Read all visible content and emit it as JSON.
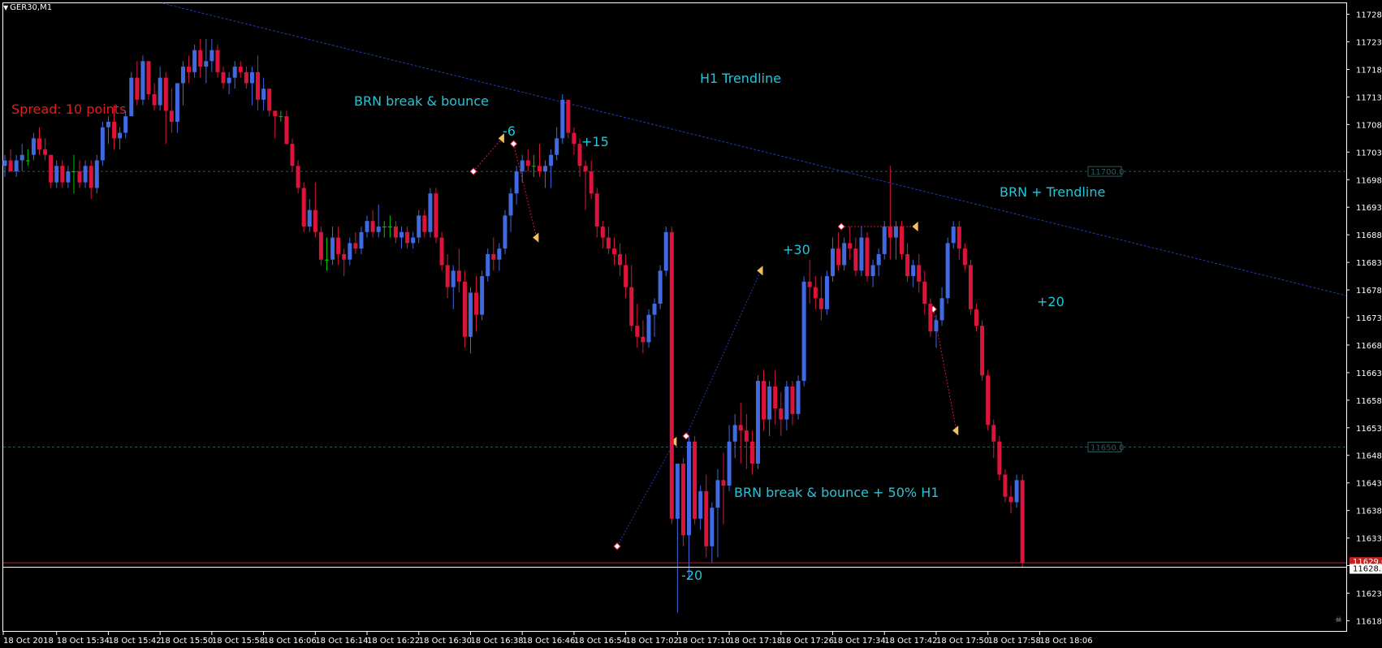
{
  "symbol_title": "GER30,M1",
  "chart_data": {
    "type": "candlestick",
    "title": "GER30,M1",
    "xlabel": "",
    "ylabel": "",
    "ylim": [
      11616.5,
      11730.5
    ],
    "price_ticks": [
      "11728.5",
      "11723.5",
      "11718.5",
      "11713.5",
      "11708.5",
      "11703.5",
      "11698.5",
      "11693.5",
      "11688.5",
      "11683.5",
      "11678.5",
      "11673.5",
      "11668.5",
      "11663.5",
      "11658.5",
      "11653.5",
      "11648.5",
      "11643.5",
      "11638.5",
      "11633.5",
      "11628.5",
      "11623.5",
      "11618.5"
    ],
    "time_ticks": [
      "18 Oct 2018",
      "18 Oct 15:34",
      "18 Oct 15:42",
      "18 Oct 15:50",
      "18 Oct 15:58",
      "18 Oct 16:06",
      "18 Oct 16:14",
      "18 Oct 16:22",
      "18 Oct 16:30",
      "18 Oct 16:38",
      "18 Oct 16:46",
      "18 Oct 16:54",
      "18 Oct 17:02",
      "18 Oct 17:10",
      "18 Oct 17:18",
      "18 Oct 17:26",
      "18 Oct 17:34",
      "18 Oct 17:42",
      "18 Oct 17:50",
      "18 Oct 17:58",
      "18 Oct 18:06"
    ],
    "grid": false,
    "colors": {
      "background": "#000000",
      "bull": "#4169E1",
      "bear": "#DC143C",
      "doji": "#00C800",
      "axis_text": "#FFFFFF",
      "trendline": "#1E3CB4",
      "level_line": "#2E5A5A",
      "bid_line": "#C81E1E",
      "ask_line": "#FFFFFF",
      "annotation": "#1EC8DC",
      "spread_text": "#E01E1E"
    },
    "candles": [
      [
        11701,
        11703,
        11699,
        11702
      ],
      [
        11702,
        11704,
        11700,
        11700
      ],
      [
        11700,
        11703,
        11699,
        11702
      ],
      [
        11702,
        11705,
        11700,
        11703
      ],
      [
        11702,
        11704,
        11701,
        11702
      ],
      [
        11703,
        11707,
        11702,
        11706
      ],
      [
        11706,
        11708,
        11703,
        11704
      ],
      [
        11704,
        11706,
        11702,
        11703
      ],
      [
        11703,
        11703,
        11697,
        11698
      ],
      [
        11698,
        11702,
        11697,
        11701
      ],
      [
        11701,
        11702,
        11697,
        11698
      ],
      [
        11698,
        11701,
        11697,
        11700
      ],
      [
        11700,
        11703,
        11696,
        11700
      ],
      [
        11700,
        11702,
        11697,
        11698
      ],
      [
        11698,
        11702,
        11697,
        11701
      ],
      [
        11701,
        11702,
        11695,
        11697
      ],
      [
        11697,
        11703,
        11696,
        11702
      ],
      [
        11702,
        11709,
        11701,
        11708
      ],
      [
        11708,
        11710,
        11705,
        11709
      ],
      [
        11709,
        11712,
        11704,
        11706
      ],
      [
        11706,
        11708,
        11704,
        11707
      ],
      [
        11707,
        11711,
        11706,
        11710
      ],
      [
        11710,
        11718,
        11710,
        11717
      ],
      [
        11717,
        11720,
        11712,
        11713
      ],
      [
        11713,
        11721,
        11712,
        11720
      ],
      [
        11720,
        11720,
        11713,
        11714
      ],
      [
        11714,
        11716,
        11711,
        11712
      ],
      [
        11712,
        11719,
        11711,
        11717
      ],
      [
        11717,
        11718,
        11705,
        11711
      ],
      [
        11711,
        11715,
        11707,
        11709
      ],
      [
        11709,
        11716,
        11707,
        11716
      ],
      [
        11716,
        11720,
        11712,
        11719
      ],
      [
        11719,
        11721,
        11716,
        11718
      ],
      [
        11718,
        11723,
        11717,
        11722
      ],
      [
        11722,
        11724,
        11717,
        11719
      ],
      [
        11719,
        11724,
        11716,
        11720
      ],
      [
        11720,
        11724,
        11718,
        11722
      ],
      [
        11722,
        11723,
        11717,
        11718
      ],
      [
        11718,
        11719,
        11715,
        11716
      ],
      [
        11716,
        11718,
        11714,
        11717
      ],
      [
        11717,
        11720,
        11715,
        11719
      ],
      [
        11719,
        11720,
        11717,
        11718
      ],
      [
        11718,
        11719,
        11715,
        11716
      ],
      [
        11716,
        11719,
        11712,
        11718
      ],
      [
        11718,
        11721,
        11711,
        11713
      ],
      [
        11713,
        11717,
        11711,
        11715
      ],
      [
        11715,
        11715,
        11710,
        11711
      ],
      [
        11711,
        11711,
        11706,
        11710
      ],
      [
        11710,
        11711,
        11709,
        11710
      ],
      [
        11710,
        11711,
        11705,
        11705
      ],
      [
        11705,
        11706,
        11700,
        11701
      ],
      [
        11701,
        11702,
        11696,
        11697
      ],
      [
        11697,
        11698,
        11689,
        11690
      ],
      [
        11690,
        11695,
        11689,
        11693
      ],
      [
        11693,
        11698,
        11688,
        11689
      ],
      [
        11689,
        11690,
        11683,
        11684
      ],
      [
        11684,
        11688,
        11682,
        11684
      ],
      [
        11684,
        11690,
        11683,
        11688
      ],
      [
        11688,
        11690,
        11683,
        11685
      ],
      [
        11685,
        11686,
        11681,
        11684
      ],
      [
        11684,
        11688,
        11683,
        11687
      ],
      [
        11687,
        11689,
        11685,
        11686
      ],
      [
        11686,
        11690,
        11685,
        11689
      ],
      [
        11689,
        11692,
        11688,
        11691
      ],
      [
        11691,
        11693,
        11688,
        11689
      ],
      [
        11689,
        11694,
        11688,
        11690
      ],
      [
        11690,
        11691,
        11688,
        11690
      ],
      [
        11690,
        11692,
        11688,
        11690
      ],
      [
        11690,
        11691,
        11687,
        11688
      ],
      [
        11688,
        11690,
        11686,
        11689
      ],
      [
        11689,
        11690,
        11686,
        11687
      ],
      [
        11687,
        11689,
        11686,
        11688
      ],
      [
        11688,
        11693,
        11687,
        11692
      ],
      [
        11692,
        11693,
        11688,
        11689
      ],
      [
        11689,
        11697,
        11688,
        11696
      ],
      [
        11696,
        11697,
        11687,
        11688
      ],
      [
        11688,
        11689,
        11682,
        11683
      ],
      [
        11683,
        11685,
        11677,
        11679
      ],
      [
        11679,
        11683,
        11675,
        11682
      ],
      [
        11682,
        11686,
        11678,
        11680
      ],
      [
        11680,
        11682,
        11668,
        11670
      ],
      [
        11670,
        11679,
        11667,
        11678
      ],
      [
        11678,
        11681,
        11671,
        11674
      ],
      [
        11674,
        11682,
        11673,
        11681
      ],
      [
        11681,
        11686,
        11680,
        11685
      ],
      [
        11685,
        11688,
        11682,
        11684
      ],
      [
        11684,
        11687,
        11682,
        11686
      ],
      [
        11686,
        11693,
        11685,
        11692
      ],
      [
        11692,
        11697,
        11689,
        11696
      ],
      [
        11696,
        11701,
        11694,
        11700
      ],
      [
        11700,
        11703,
        11698,
        11702
      ],
      [
        11702,
        11704,
        11700,
        11701
      ],
      [
        11701,
        11703,
        11699,
        11701
      ],
      [
        11701,
        11705,
        11699,
        11700
      ],
      [
        11700,
        11702,
        11697,
        11701
      ],
      [
        11701,
        11704,
        11697,
        11703
      ],
      [
        11703,
        11708,
        11702,
        11706
      ],
      [
        11706,
        11714,
        11705,
        11713
      ],
      [
        11713,
        11713,
        11706,
        11707
      ],
      [
        11707,
        11708,
        11703,
        11705
      ],
      [
        11705,
        11706,
        11699,
        11701
      ],
      [
        11701,
        11702,
        11693,
        11700
      ],
      [
        11700,
        11702,
        11695,
        11696
      ],
      [
        11696,
        11697,
        11688,
        11690
      ],
      [
        11690,
        11691,
        11686,
        11688
      ],
      [
        11688,
        11690,
        11685,
        11686
      ],
      [
        11686,
        11688,
        11683,
        11685
      ],
      [
        11685,
        11687,
        11681,
        11683
      ],
      [
        11683,
        11685,
        11677,
        11679
      ],
      [
        11679,
        11683,
        11671,
        11672
      ],
      [
        11672,
        11676,
        11668,
        11670
      ],
      [
        11670,
        11673,
        11667,
        11669
      ],
      [
        11669,
        11675,
        11668,
        11674
      ],
      [
        11674,
        11677,
        11670,
        11676
      ],
      [
        11676,
        11683,
        11675,
        11682
      ],
      [
        11682,
        11690,
        11681,
        11689
      ],
      [
        11689,
        11690,
        11636,
        11637
      ],
      [
        11637,
        11646,
        11620,
        11647
      ],
      [
        11647,
        11648,
        11632,
        11634
      ],
      [
        11634,
        11652,
        11626,
        11651
      ],
      [
        11651,
        11652,
        11636,
        11637
      ],
      [
        11637,
        11643,
        11635,
        11642
      ],
      [
        11642,
        11645,
        11630,
        11632
      ],
      [
        11632,
        11640,
        11629,
        11639
      ],
      [
        11639,
        11646,
        11630,
        11644
      ],
      [
        11644,
        11649,
        11636,
        11643
      ],
      [
        11643,
        11654,
        11642,
        11651
      ],
      [
        11651,
        11656,
        11648,
        11654
      ],
      [
        11654,
        11658,
        11647,
        11653
      ],
      [
        11653,
        11656,
        11646,
        11651
      ],
      [
        11651,
        11653,
        11645,
        11647
      ],
      [
        11647,
        11663,
        11646,
        11662
      ],
      [
        11662,
        11664,
        11653,
        11655
      ],
      [
        11655,
        11662,
        11652,
        11661
      ],
      [
        11661,
        11664,
        11654,
        11657
      ],
      [
        11657,
        11660,
        11652,
        11655
      ],
      [
        11655,
        11662,
        11653,
        11661
      ],
      [
        11661,
        11662,
        11654,
        11656
      ],
      [
        11656,
        11663,
        11655,
        11662
      ],
      [
        11662,
        11681,
        11661,
        11680
      ],
      [
        11680,
        11684,
        11676,
        11679
      ],
      [
        11679,
        11681,
        11675,
        11677
      ],
      [
        11677,
        11681,
        11673,
        11675
      ],
      [
        11675,
        11682,
        11674,
        11681
      ],
      [
        11681,
        11688,
        11680,
        11686
      ],
      [
        11686,
        11689,
        11682,
        11683
      ],
      [
        11683,
        11688,
        11682,
        11687
      ],
      [
        11687,
        11690,
        11684,
        11686
      ],
      [
        11686,
        11688,
        11681,
        11682
      ],
      [
        11682,
        11690,
        11681,
        11688
      ],
      [
        11688,
        11689,
        11680,
        11681
      ],
      [
        11681,
        11684,
        11679,
        11683
      ],
      [
        11683,
        11686,
        11681,
        11685
      ],
      [
        11685,
        11691,
        11684,
        11690
      ],
      [
        11690,
        11701,
        11684,
        11688
      ],
      [
        11688,
        11691,
        11684,
        11690
      ],
      [
        11690,
        11691,
        11684,
        11685
      ],
      [
        11685,
        11687,
        11680,
        11681
      ],
      [
        11681,
        11684,
        11679,
        11683
      ],
      [
        11683,
        11685,
        11678,
        11680
      ],
      [
        11680,
        11682,
        11674,
        11676
      ],
      [
        11676,
        11677,
        11670,
        11671
      ],
      [
        11671,
        11674,
        11668,
        11673
      ],
      [
        11673,
        11679,
        11672,
        11677
      ],
      [
        11677,
        11688,
        11676,
        11687
      ],
      [
        11687,
        11691,
        11686,
        11690
      ],
      [
        11690,
        11691,
        11684,
        11686
      ],
      [
        11686,
        11687,
        11682,
        11683
      ],
      [
        11683,
        11684,
        11674,
        11675
      ],
      [
        11675,
        11676,
        11671,
        11672
      ],
      [
        11672,
        11673,
        11662,
        11663
      ],
      [
        11663,
        11664,
        11653,
        11654
      ],
      [
        11654,
        11655,
        11648,
        11651
      ],
      [
        11651,
        11652,
        11644,
        11645
      ],
      [
        11645,
        11646,
        11640,
        11641
      ],
      [
        11641,
        11643,
        11638,
        11640
      ],
      [
        11640,
        11645,
        11639,
        11644
      ],
      [
        11644,
        11645,
        11628,
        11629
      ]
    ],
    "level_labels": [
      "11700.0",
      "11650.0"
    ],
    "bid_label": "11629.0",
    "ask_label": "11628.5",
    "annotations": [
      {
        "text": "Spread: 10 points",
        "kind": "spread"
      },
      {
        "text": "BRN break & bounce",
        "kind": "note"
      },
      {
        "text": "H1 Trendline",
        "kind": "note"
      },
      {
        "text": "-6",
        "kind": "note"
      },
      {
        "text": "+15",
        "kind": "note"
      },
      {
        "text": "BRN + Trendline",
        "kind": "note"
      },
      {
        "text": "+30",
        "kind": "note"
      },
      {
        "text": "+20",
        "kind": "note"
      },
      {
        "text": "BRN break & bounce + 50% H1",
        "kind": "note"
      },
      {
        "text": "-20",
        "kind": "note"
      }
    ]
  }
}
